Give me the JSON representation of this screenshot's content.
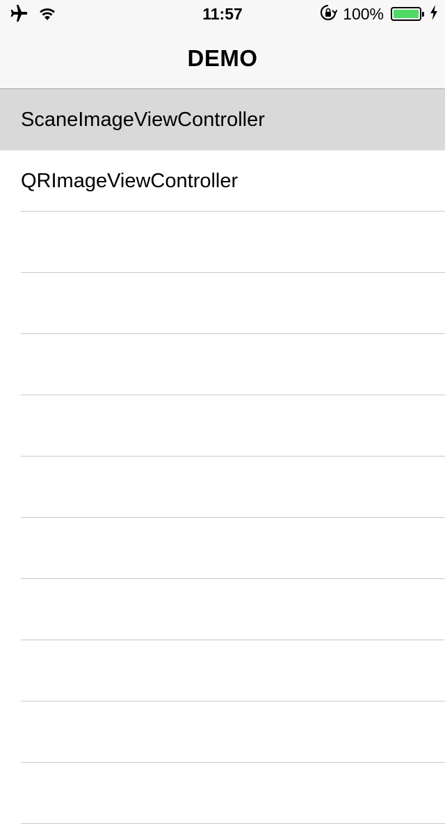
{
  "status_bar": {
    "time": "11:57",
    "battery_percent": "100%",
    "battery_level": 1.0,
    "left_icons": [
      "airplane-icon",
      "wifi-icon"
    ],
    "right_icons": [
      "rotation-lock-icon",
      "battery-icon",
      "charging-bolt-icon"
    ],
    "battery_color": "#4cd964"
  },
  "nav": {
    "title": "DEMO"
  },
  "table": {
    "rows": [
      {
        "label": "ScaneImageViewController",
        "selected": true
      },
      {
        "label": "QRImageViewController",
        "selected": false
      },
      {
        "label": "",
        "selected": false
      },
      {
        "label": "",
        "selected": false
      },
      {
        "label": "",
        "selected": false
      },
      {
        "label": "",
        "selected": false
      },
      {
        "label": "",
        "selected": false
      },
      {
        "label": "",
        "selected": false
      },
      {
        "label": "",
        "selected": false
      },
      {
        "label": "",
        "selected": false
      },
      {
        "label": "",
        "selected": false
      },
      {
        "label": "",
        "selected": false
      }
    ],
    "selected_color": "#d9d9d9",
    "separator_color": "#c8c7cc"
  }
}
